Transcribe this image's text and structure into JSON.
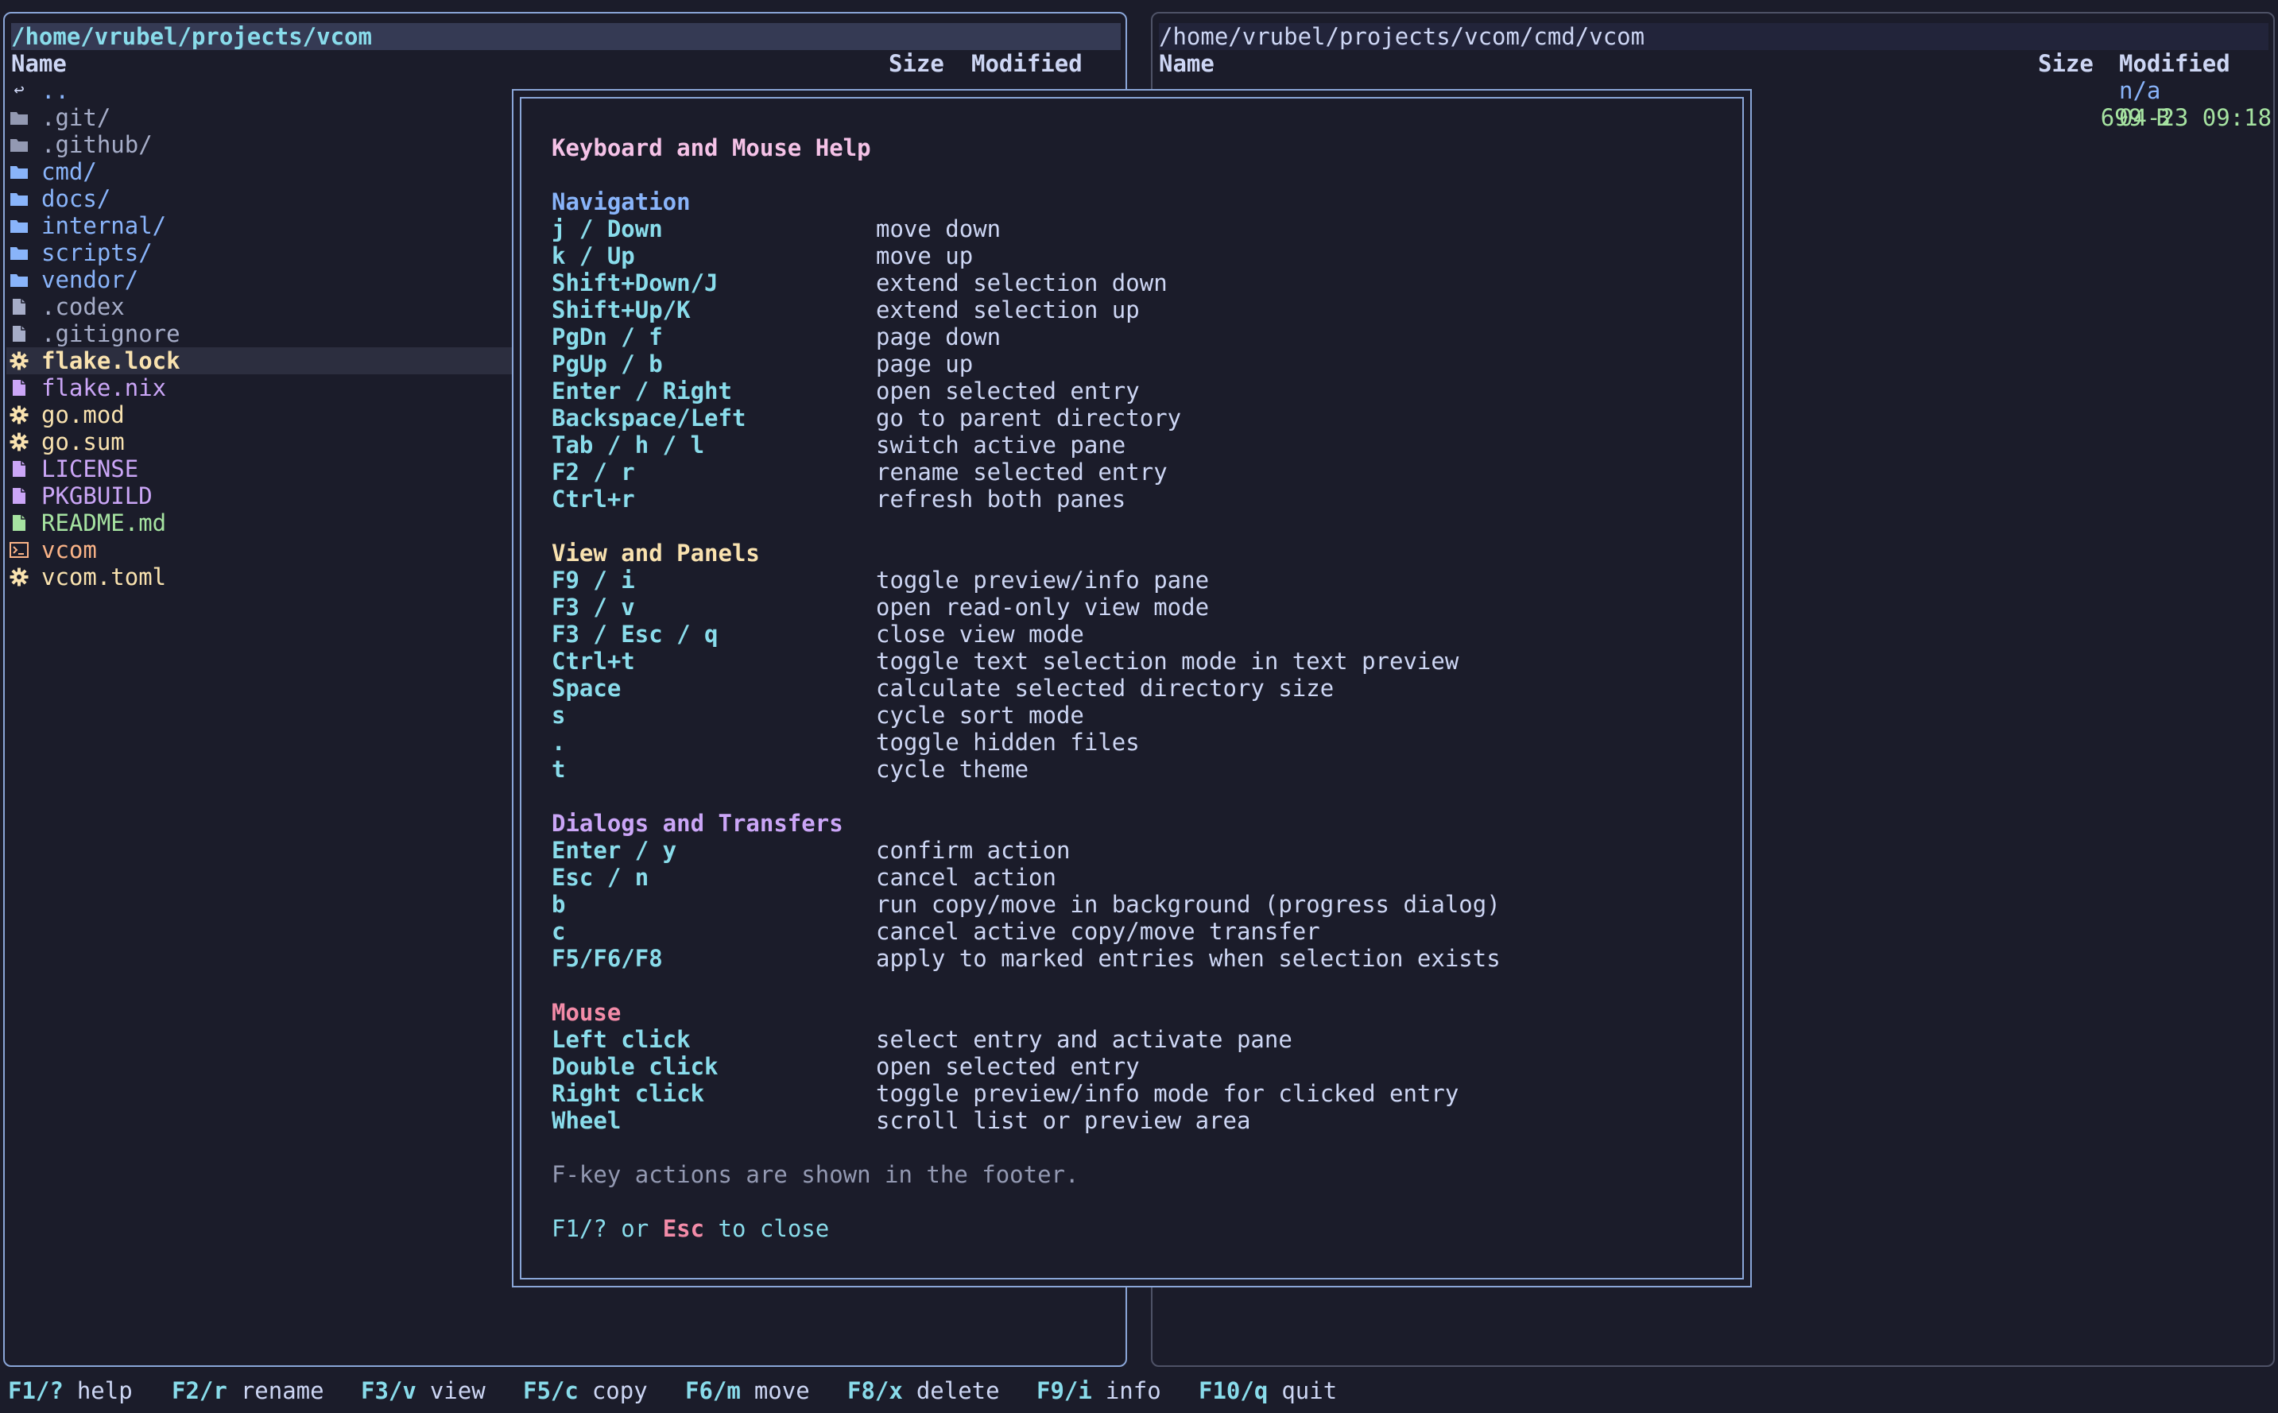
{
  "colors": {
    "background": "#1b1c2a",
    "active_border": "#8aa6d8",
    "inactive_border": "#4e5266",
    "dir": "#89b4fa",
    "hidden": "#a6adc8",
    "config": "#f9e2af",
    "doc": "#cba6f7",
    "markdown": "#a6e3a1",
    "exec": "#fab387",
    "key": "#89dceb",
    "section_nav": "#89b4fa",
    "section_view": "#f9e2af",
    "section_dialogs": "#cba6f7",
    "section_mouse": "#f38ba8",
    "selection_bg": "#2c2e3f"
  },
  "left_pane": {
    "path": "/home/vrubel/projects/vcom",
    "columns": {
      "name": "Name",
      "size": "Size",
      "modified": "Modified"
    },
    "entries": [
      {
        "name": "..",
        "icon": "return-arrow-icon"
      },
      {
        "name": ".git/",
        "icon": "folder-icon"
      },
      {
        "name": ".github/",
        "icon": "folder-icon"
      },
      {
        "name": "cmd/",
        "icon": "folder-icon"
      },
      {
        "name": "docs/",
        "icon": "folder-icon"
      },
      {
        "name": "internal/",
        "icon": "folder-icon"
      },
      {
        "name": "scripts/",
        "icon": "folder-icon"
      },
      {
        "name": "vendor/",
        "icon": "folder-icon"
      },
      {
        "name": ".codex",
        "icon": "file-icon"
      },
      {
        "name": ".gitignore",
        "icon": "file-icon"
      },
      {
        "name": "flake.lock",
        "icon": "gear-icon"
      },
      {
        "name": "flake.nix",
        "icon": "file-icon"
      },
      {
        "name": "go.mod",
        "icon": "gear-icon"
      },
      {
        "name": "go.sum",
        "icon": "gear-icon"
      },
      {
        "name": "LICENSE",
        "icon": "file-icon"
      },
      {
        "name": "PKGBUILD",
        "icon": "file-icon"
      },
      {
        "name": "README.md",
        "icon": "file-icon"
      },
      {
        "name": "vcom",
        "icon": "terminal-icon"
      },
      {
        "name": "vcom.toml",
        "icon": "gear-icon"
      }
    ]
  },
  "right_pane": {
    "path": "/home/vrubel/projects/vcom/cmd/vcom",
    "columns": {
      "name": "Name",
      "size": "Size",
      "modified": "Modified"
    },
    "rows": [
      {
        "size": "",
        "modified": "n/a"
      },
      {
        "size": "699 B",
        "modified": "04-23 09:18"
      }
    ]
  },
  "help": {
    "title": "Keyboard and Mouse Help",
    "sections": [
      {
        "title": "Navigation",
        "items": [
          {
            "key": "j / Down",
            "desc": "move down"
          },
          {
            "key": "k / Up",
            "desc": "move up"
          },
          {
            "key": "Shift+Down/J",
            "desc": "extend selection down"
          },
          {
            "key": "Shift+Up/K",
            "desc": "extend selection up"
          },
          {
            "key": "PgDn / f",
            "desc": "page down"
          },
          {
            "key": "PgUp / b",
            "desc": "page up"
          },
          {
            "key": "Enter / Right",
            "desc": "open selected entry"
          },
          {
            "key": "Backspace/Left",
            "desc": "go to parent directory"
          },
          {
            "key": "Tab / h / l",
            "desc": "switch active pane"
          },
          {
            "key": "F2 / r",
            "desc": "rename selected entry"
          },
          {
            "key": "Ctrl+r",
            "desc": "refresh both panes"
          }
        ]
      },
      {
        "title": "View and Panels",
        "items": [
          {
            "key": "F9 / i",
            "desc": "toggle preview/info pane"
          },
          {
            "key": "F3 / v",
            "desc": "open read-only view mode"
          },
          {
            "key": "F3 / Esc / q",
            "desc": "close view mode"
          },
          {
            "key": "Ctrl+t",
            "desc": "toggle text selection mode in text preview"
          },
          {
            "key": "Space",
            "desc": "calculate selected directory size"
          },
          {
            "key": "s",
            "desc": "cycle sort mode"
          },
          {
            "key": ".",
            "desc": "toggle hidden files"
          },
          {
            "key": "t",
            "desc": "cycle theme"
          }
        ]
      },
      {
        "title": "Dialogs and Transfers",
        "items": [
          {
            "key": "Enter / y",
            "desc": "confirm action"
          },
          {
            "key": "Esc / n",
            "desc": "cancel action"
          },
          {
            "key": "b",
            "desc": "run copy/move in background (progress dialog)"
          },
          {
            "key": "c",
            "desc": "cancel active copy/move transfer"
          },
          {
            "key": "F5/F6/F8",
            "desc": "apply to marked entries when selection exists"
          }
        ]
      },
      {
        "title": "Mouse",
        "items": [
          {
            "key": "Left click",
            "desc": "select entry and activate pane"
          },
          {
            "key": "Double click",
            "desc": "open selected entry"
          },
          {
            "key": "Right click",
            "desc": "toggle preview/info mode for clicked entry"
          },
          {
            "key": "Wheel",
            "desc": "scroll list or preview area"
          }
        ]
      }
    ],
    "note": "F-key actions are shown in the footer.",
    "close_prefix": "F1/? or ",
    "close_key": "Esc",
    "close_suffix": " to close"
  },
  "footer": [
    {
      "key": "F1/?",
      "label": "help"
    },
    {
      "key": "F2/r",
      "label": "rename"
    },
    {
      "key": "F3/v",
      "label": "view"
    },
    {
      "key": "F5/c",
      "label": "copy"
    },
    {
      "key": "F6/m",
      "label": "move"
    },
    {
      "key": "F8/x",
      "label": "delete"
    },
    {
      "key": "F9/i",
      "label": "info"
    },
    {
      "key": "F10/q",
      "label": "quit"
    }
  ]
}
